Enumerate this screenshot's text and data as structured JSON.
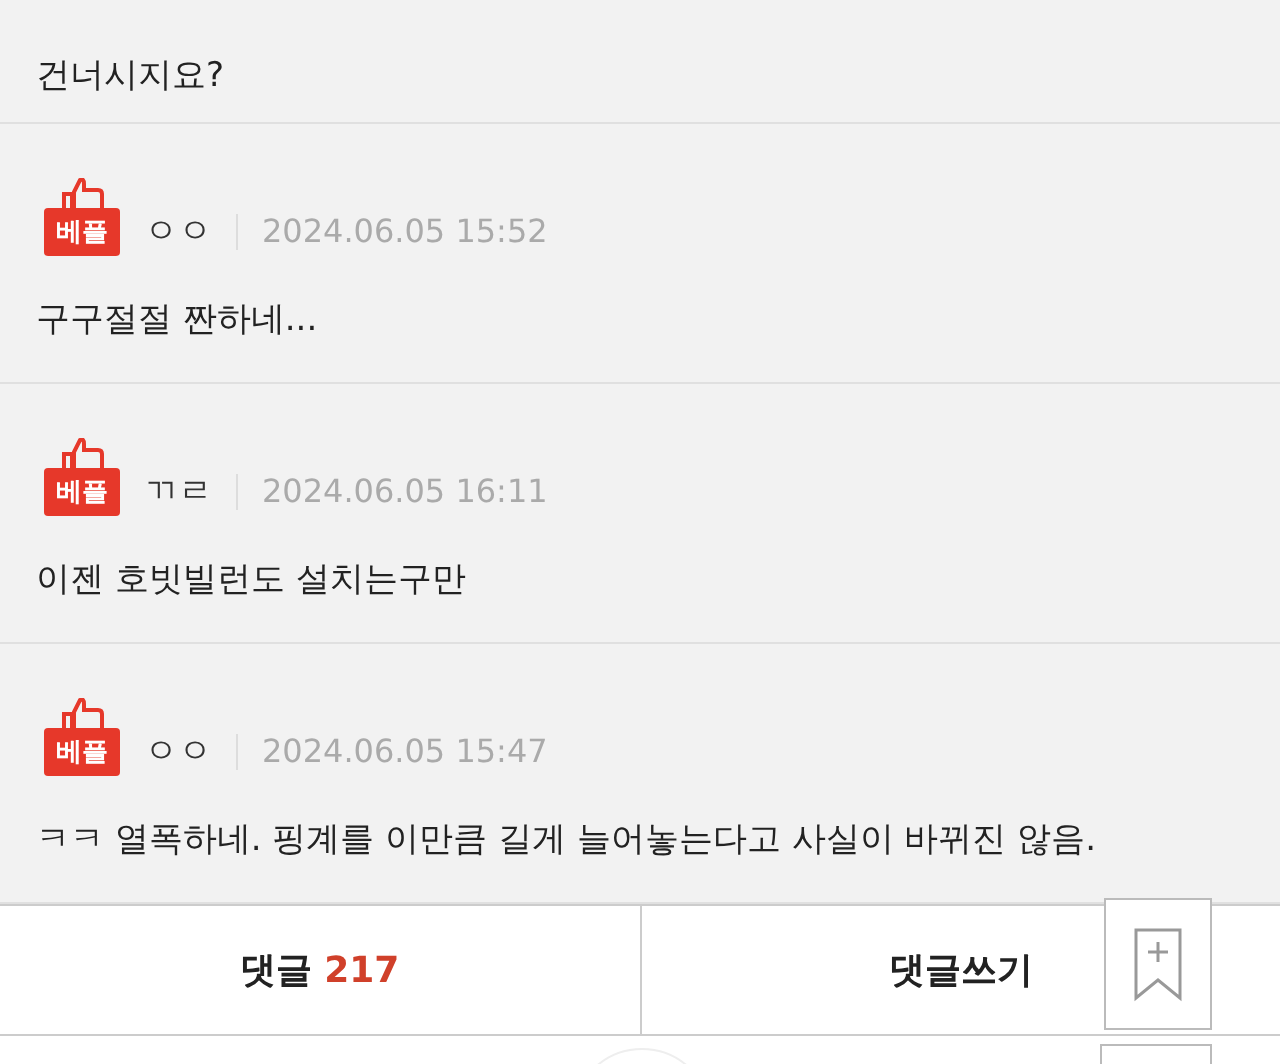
{
  "previous_comment_tail": "건너시지요?",
  "comments": [
    {
      "badge": "베플",
      "author": "ㅇㅇ",
      "date": "2024.06.05 15:52",
      "text": "구구절절 짠하네..."
    },
    {
      "badge": "베플",
      "author": "ㄲㄹ",
      "date": "2024.06.05 16:11",
      "text": "이젠 호빗빌런도 설치는구만"
    },
    {
      "badge": "베플",
      "author": "ㅇㅇ",
      "date": "2024.06.05 15:47",
      "text": "ㅋㅋ 열폭하네. 핑계를 이만큼 길게 늘어놓는다고 사실이 바뀌진 않음."
    }
  ],
  "bottom_bar": {
    "comments_label": "댓글",
    "comments_count": "217",
    "write_label": "댓글쓰기"
  }
}
